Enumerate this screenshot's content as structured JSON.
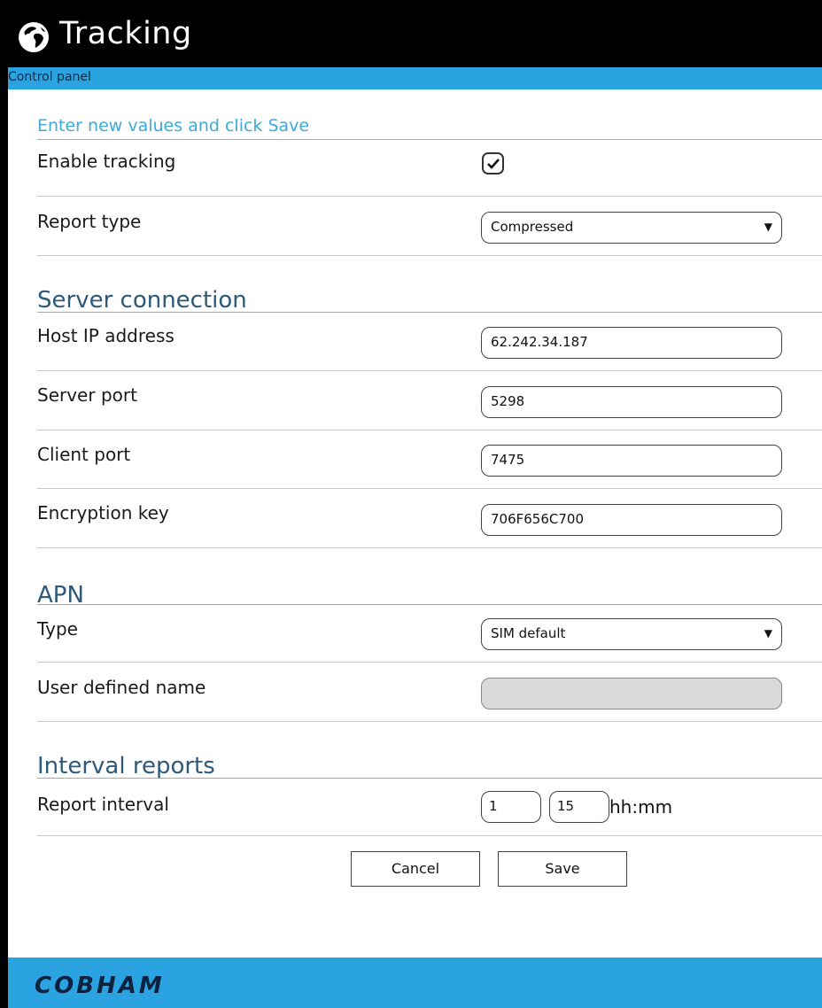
{
  "header": {
    "title": "Tracking",
    "icon": "globe-icon"
  },
  "subbar": {
    "label": "Control panel"
  },
  "form": {
    "lead": "Enter new values and click Save",
    "enable_tracking": {
      "label": "Enable tracking",
      "checked": true
    },
    "report_type": {
      "label": "Report type",
      "value": "Compressed"
    },
    "server": {
      "title": "Server connection",
      "host_ip": {
        "label": "Host IP address",
        "value": "62.242.34.187"
      },
      "server_port": {
        "label": "Server port",
        "value": "5298"
      },
      "client_port": {
        "label": "Client port",
        "value": "7475"
      },
      "encryption_key": {
        "label": "Encryption key",
        "value": "706F656C700"
      }
    },
    "apn": {
      "title": "APN",
      "type": {
        "label": "Type",
        "value": "SIM default"
      },
      "user_defined_name": {
        "label": "User defined name",
        "value": ""
      }
    },
    "interval": {
      "title": "Interval reports",
      "report_interval": {
        "label": "Report interval",
        "hours": "1",
        "minutes": "15",
        "unit": "hh:mm"
      }
    },
    "buttons": {
      "cancel": "Cancel",
      "save": "Save"
    }
  },
  "footer": {
    "brand": "COBHAM"
  },
  "colors": {
    "accent": "#2aa3e0",
    "header_bg": "#000000",
    "section_title": "#2d5a7a",
    "lead_text": "#3fa9d9"
  }
}
